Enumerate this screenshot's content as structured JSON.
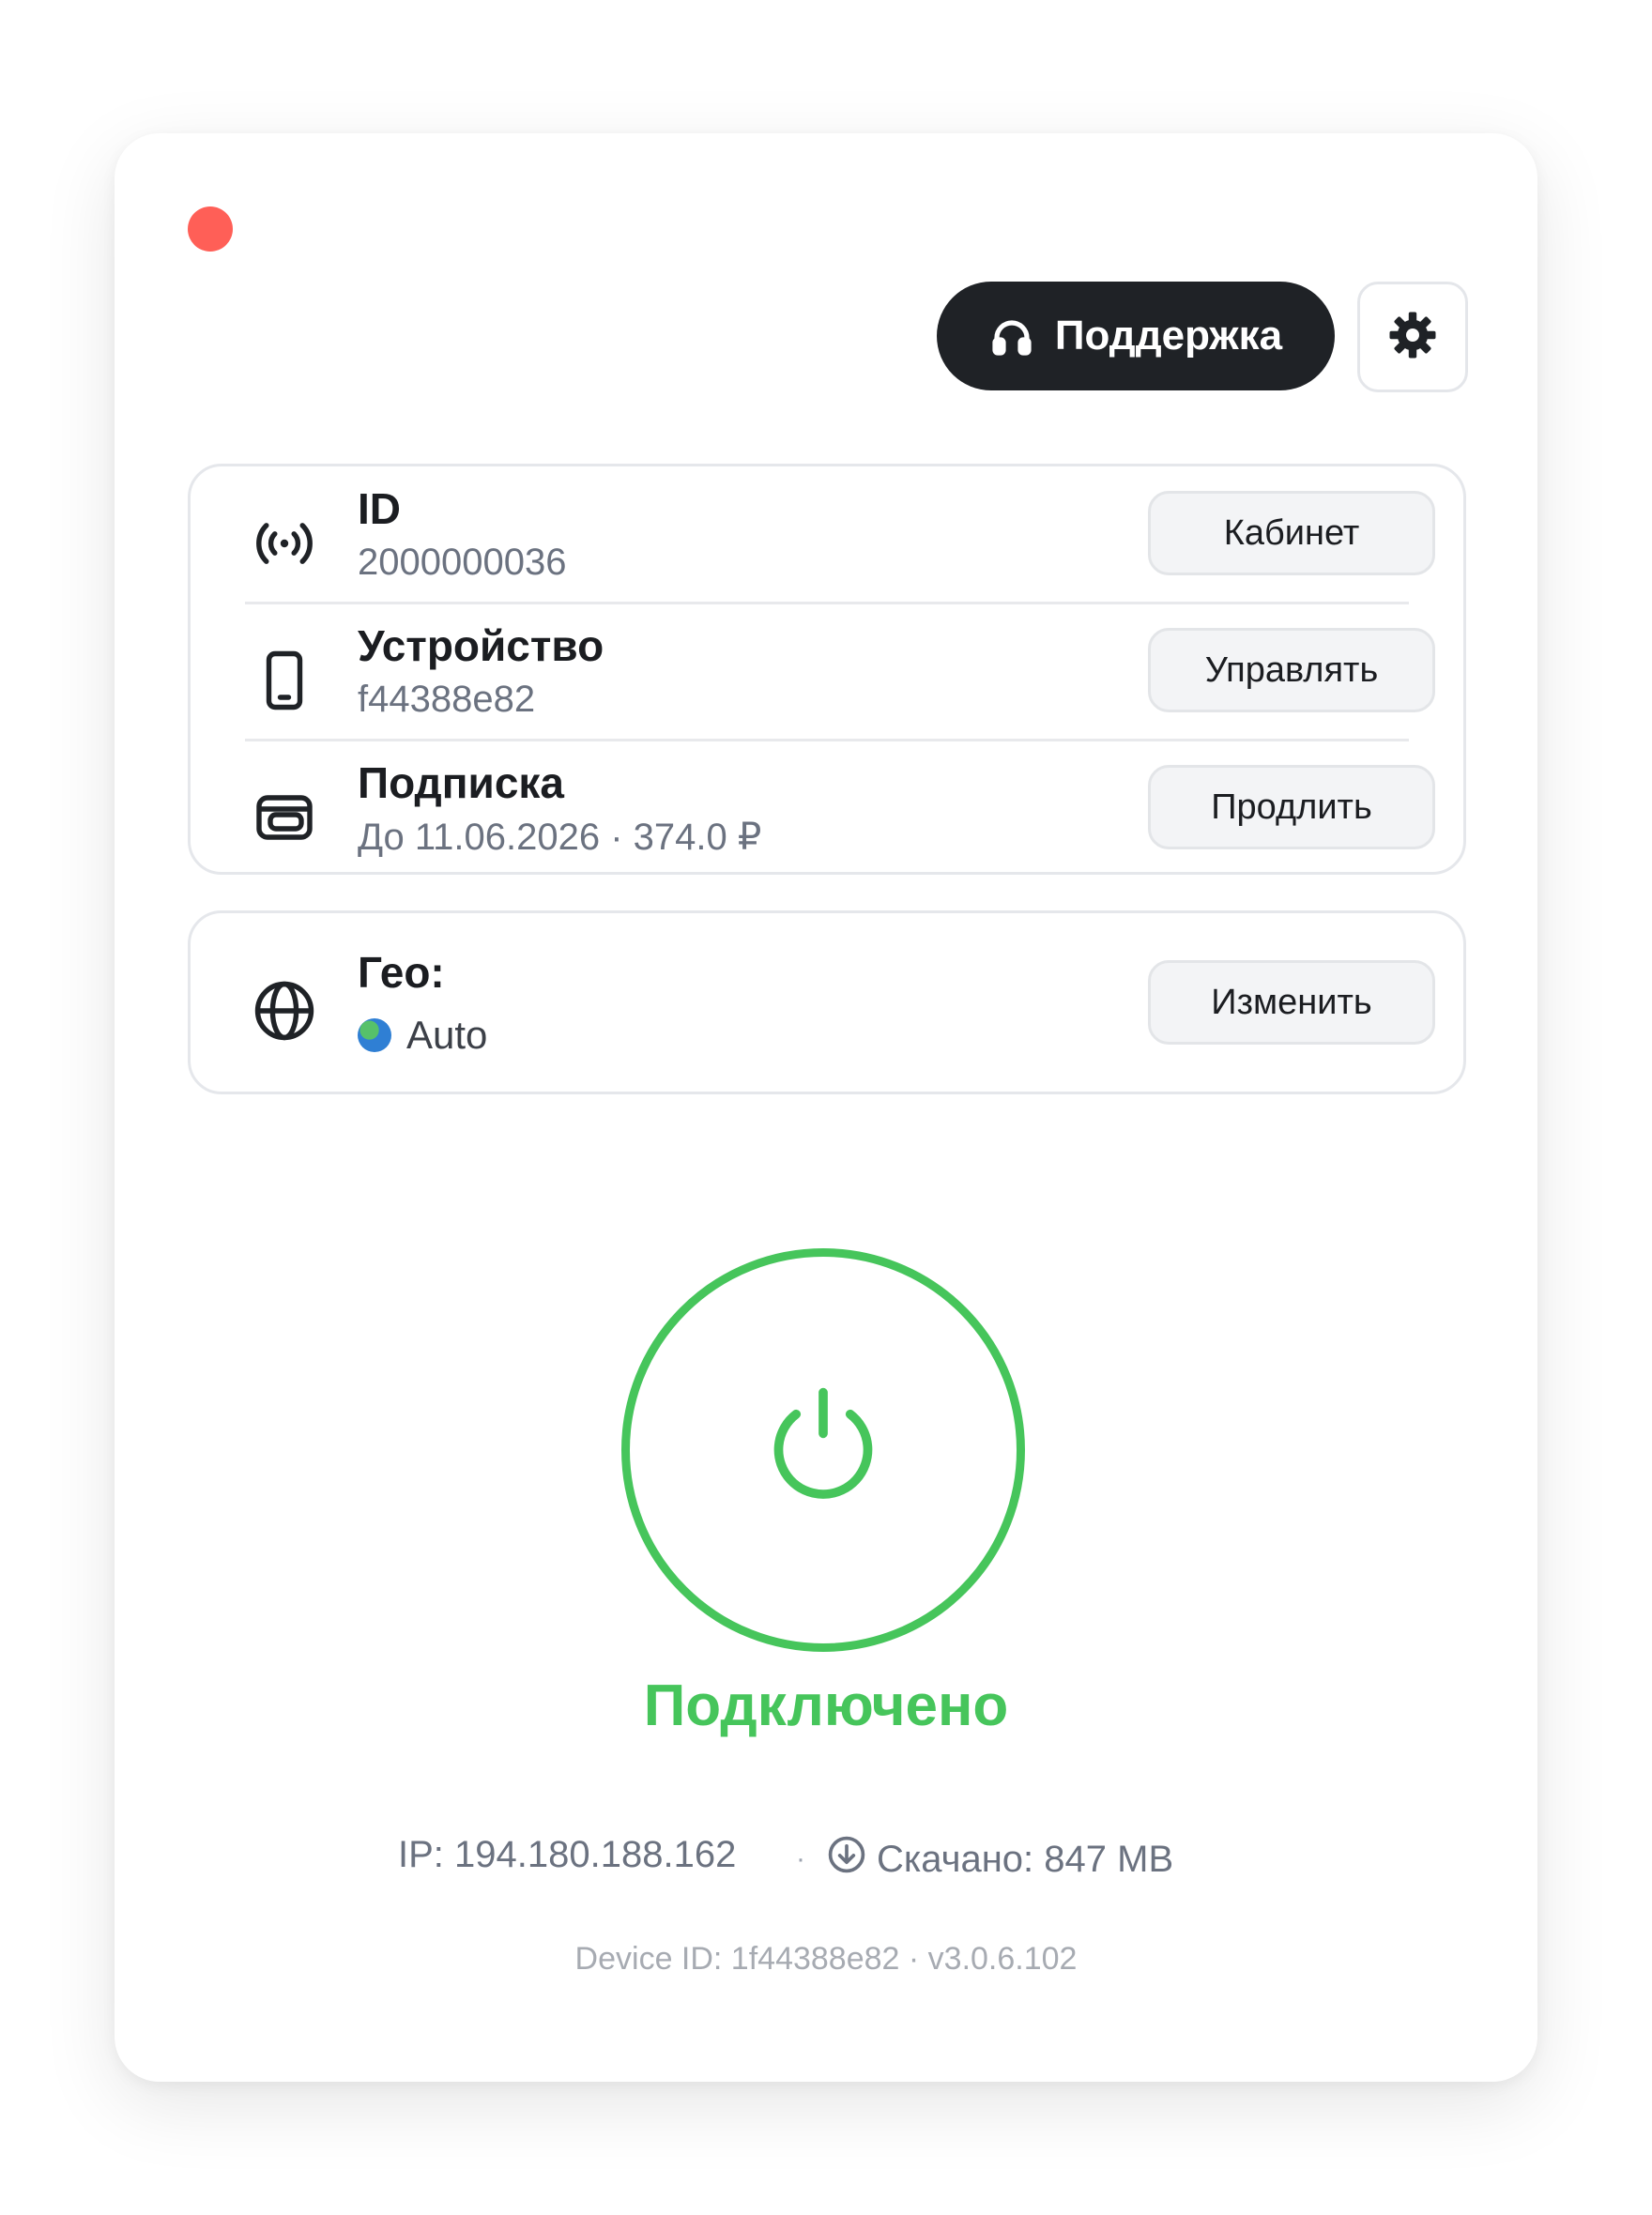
{
  "window": {
    "support_button": "Поддержка",
    "rows": [
      {
        "title": "ID",
        "value": "2000000036",
        "action": "Кабинет"
      },
      {
        "title": "Устройство",
        "value": "f44388e82",
        "action": "Управлять"
      },
      {
        "title": "Подписка",
        "value": "До 11.06.2026 · 374.0 ₽",
        "action": "Продлить"
      }
    ],
    "geo": {
      "title": "Гео:",
      "value": "Auto",
      "action": "Изменить"
    },
    "status": "Подключено",
    "ip": "IP: 194.180.188.162",
    "separator": "·",
    "downloaded": "Скачано: 847 MB",
    "footer": "Device ID: 1f44388e82 · v3.0.6.102"
  },
  "colors": {
    "accent_green": "#46c55b",
    "close_red": "#ff5f57",
    "support_bg": "#1f2226"
  },
  "icons": [
    "close-dot",
    "headphones-icon",
    "gear-icon",
    "signal-icon",
    "phone-icon",
    "subscription-card-icon",
    "globe-icon",
    "globe-flag-icon",
    "power-icon",
    "download-icon"
  ]
}
